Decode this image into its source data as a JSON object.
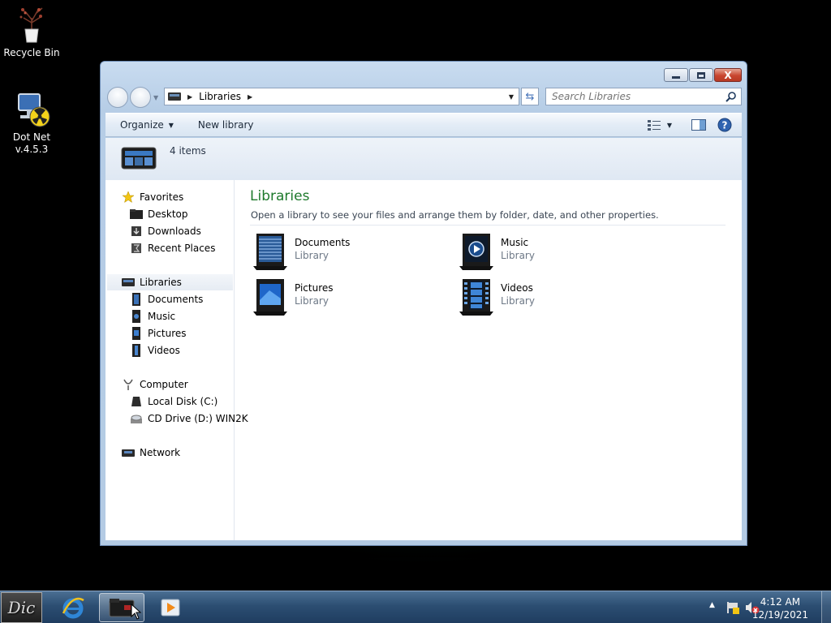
{
  "desktop": {
    "icons": [
      {
        "label": "Recycle Bin",
        "icon": "recycle-bin-plant-icon"
      },
      {
        "label_line1": "Dot Net",
        "label_line2": "v.4.5.3",
        "icon": "dotnet-radiation-icon"
      }
    ]
  },
  "window": {
    "controls": {
      "minimize": "minimize",
      "maximize": "maximize",
      "close": "X"
    },
    "address": {
      "root_icon": "libraries-icon",
      "crumb": "Libraries"
    },
    "search": {
      "placeholder": "Search Libraries"
    },
    "toolbar": {
      "organize": "Organize",
      "new_library": "New library",
      "views_icon": "view-options-icon",
      "preview_icon": "preview-pane-icon",
      "help_icon": "help-icon"
    },
    "details": {
      "count": "4 items"
    },
    "nav": {
      "favorites": {
        "label": "Favorites",
        "items": [
          "Desktop",
          "Downloads",
          "Recent Places"
        ]
      },
      "libraries": {
        "label": "Libraries",
        "items": [
          "Documents",
          "Music",
          "Pictures",
          "Videos"
        ]
      },
      "computer": {
        "label": "Computer",
        "items": [
          "Local Disk (C:)",
          "CD Drive (D:) WIN2K"
        ]
      },
      "network": {
        "label": "Network"
      }
    },
    "main": {
      "title": "Libraries",
      "description": "Open a library to see your files and arrange them by folder, date, and other properties.",
      "libraries": [
        {
          "name": "Documents",
          "type": "Library"
        },
        {
          "name": "Music",
          "type": "Library"
        },
        {
          "name": "Pictures",
          "type": "Library"
        },
        {
          "name": "Videos",
          "type": "Library"
        }
      ]
    }
  },
  "taskbar": {
    "start_label": "Dic",
    "items": [
      "internet-explorer-icon",
      "explorer-folder-icon",
      "media-player-icon"
    ],
    "clock": {
      "time": "4:12 AM",
      "date": "12/19/2021"
    }
  },
  "colors": {
    "title_green": "#1e7a2c",
    "accent_blue": "#4472b8"
  }
}
